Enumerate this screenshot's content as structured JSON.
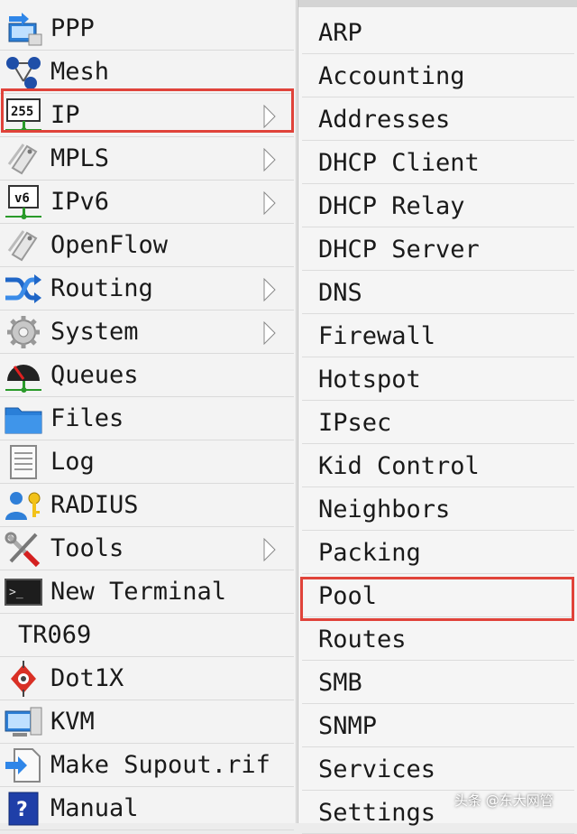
{
  "left_menu": {
    "items": [
      {
        "label": "PPP",
        "icon": "ppp-icon",
        "has_submenu": false
      },
      {
        "label": "Mesh",
        "icon": "mesh-icon",
        "has_submenu": false
      },
      {
        "label": "IP",
        "icon": "ip-255-icon",
        "has_submenu": true,
        "highlighted": true
      },
      {
        "label": "MPLS",
        "icon": "mpls-tag-icon",
        "has_submenu": true
      },
      {
        "label": "IPv6",
        "icon": "ipv6-icon",
        "has_submenu": true
      },
      {
        "label": "OpenFlow",
        "icon": "openflow-tag-icon",
        "has_submenu": false
      },
      {
        "label": "Routing",
        "icon": "routing-arrows-icon",
        "has_submenu": true
      },
      {
        "label": "System",
        "icon": "gear-icon",
        "has_submenu": true
      },
      {
        "label": "Queues",
        "icon": "gauge-icon",
        "has_submenu": false
      },
      {
        "label": "Files",
        "icon": "folder-icon",
        "has_submenu": false
      },
      {
        "label": "Log",
        "icon": "log-document-icon",
        "has_submenu": false
      },
      {
        "label": "RADIUS",
        "icon": "user-key-icon",
        "has_submenu": false
      },
      {
        "label": "Tools",
        "icon": "tools-icon",
        "has_submenu": true
      },
      {
        "label": "New Terminal",
        "icon": "terminal-icon",
        "has_submenu": false
      },
      {
        "label": "TR069",
        "icon": "",
        "has_submenu": false
      },
      {
        "label": "Dot1X",
        "icon": "dot1x-icon",
        "has_submenu": false
      },
      {
        "label": "KVM",
        "icon": "kvm-icon",
        "has_submenu": false
      },
      {
        "label": "Make Supout.rif",
        "icon": "supout-file-icon",
        "has_submenu": false
      },
      {
        "label": "Manual",
        "icon": "manual-help-icon",
        "has_submenu": false
      }
    ]
  },
  "ip_submenu": {
    "items": [
      "ARP",
      "Accounting",
      "Addresses",
      "DHCP Client",
      "DHCP Relay",
      "DHCP Server",
      "DNS",
      "Firewall",
      "Hotspot",
      "IPsec",
      "Kid Control",
      "Neighbors",
      "Packing",
      "Pool",
      "Routes",
      "SMB",
      "SNMP",
      "Services",
      "Settings"
    ],
    "highlighted": "Pool"
  },
  "colors": {
    "highlight_border": "#e0433a",
    "menu_bg": "#f3f3f3",
    "text": "#1a1a1a"
  },
  "watermark": "头条 @东大网管"
}
